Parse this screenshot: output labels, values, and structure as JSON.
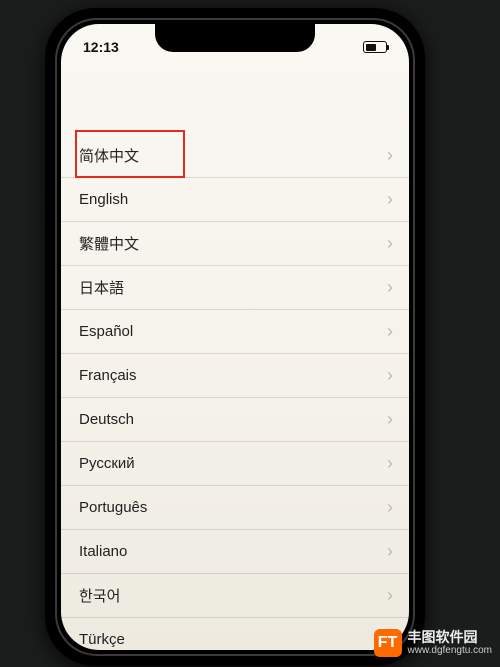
{
  "status": {
    "time": "12:13"
  },
  "languages": [
    {
      "label": "简体中文"
    },
    {
      "label": "English"
    },
    {
      "label": "繁體中文"
    },
    {
      "label": "日本語"
    },
    {
      "label": "Español"
    },
    {
      "label": "Français"
    },
    {
      "label": "Deutsch"
    },
    {
      "label": "Русский"
    },
    {
      "label": "Português"
    },
    {
      "label": "Italiano"
    },
    {
      "label": "한국어"
    },
    {
      "label": "Türkçe"
    }
  ],
  "watermark": {
    "logo_text": "FT",
    "title": "丰图软件园",
    "url": "www.dgfengtu.com"
  },
  "highlight_color": "#e52b20"
}
